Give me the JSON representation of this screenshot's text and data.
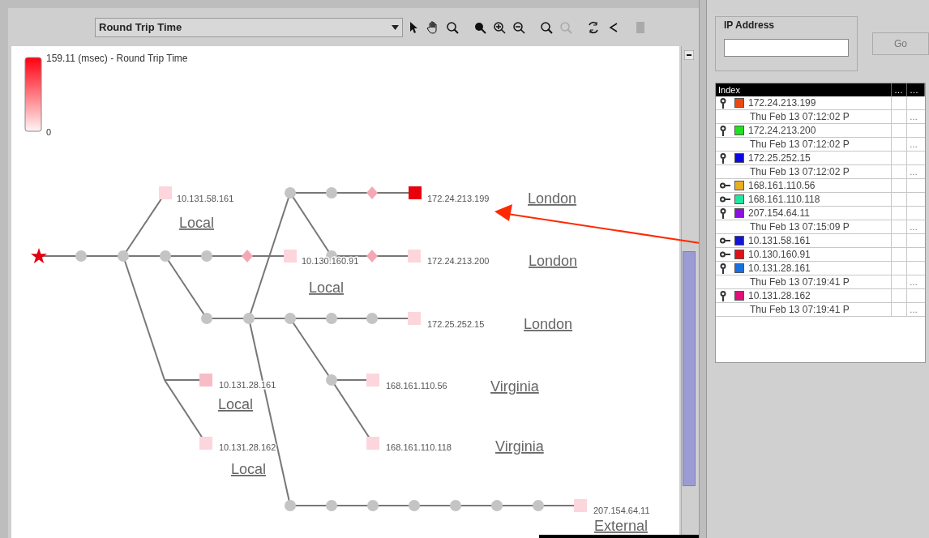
{
  "toolbar": {
    "metric_dropdown": {
      "value": "Round Trip Time"
    }
  },
  "legend": {
    "max_label": "159.11 (msec) - Round Trip Time",
    "min_label": "0"
  },
  "graph": {
    "targets": [
      {
        "ip": "10.131.58.161",
        "location": "Local",
        "color": "#fcd6dc"
      },
      {
        "ip": "172.24.213.199",
        "location": "London",
        "color": "#e8000c"
      },
      {
        "ip": "10.130.160.91",
        "location": "Local",
        "color": "#fcd6dc"
      },
      {
        "ip": "172.24.213.200",
        "location": "London",
        "color": "#fcd6dc"
      },
      {
        "ip": "172.25.252.15",
        "location": "London",
        "color": "#fcd6dc"
      },
      {
        "ip": "10.131.28.161",
        "location": "Local",
        "color": "#f8bcc6"
      },
      {
        "ip": "168.161.110.56",
        "location": "Virginia",
        "color": "#fcd6dc"
      },
      {
        "ip": "10.131.28.162",
        "location": "Local",
        "color": "#fcd6dc"
      },
      {
        "ip": "168.161.110.118",
        "location": "Virginia",
        "color": "#fcd6dc"
      },
      {
        "ip": "207.154.64.11",
        "location": "External",
        "color": "#fcd6dc"
      }
    ]
  },
  "search": {
    "label": "IP Address",
    "button": "Go",
    "button_disabled": true
  },
  "table": {
    "columns": [
      "Index",
      "…",
      "…"
    ],
    "rows": [
      {
        "ip": "172.24.213.199",
        "color": "#e84a10",
        "expanded": true,
        "children": [
          {
            "time": "Thu Feb 13 07:12:02 P",
            "column_2": "…"
          }
        ]
      },
      {
        "ip": "172.24.213.200",
        "color": "#22e022",
        "expanded": true,
        "children": [
          {
            "time": "Thu Feb 13 07:12:02 P",
            "column_2": "…"
          }
        ]
      },
      {
        "ip": "172.25.252.15",
        "color": "#0a0ae0",
        "expanded": true,
        "children": [
          {
            "time": "Thu Feb 13 07:12:02 P",
            "column_2": "…"
          }
        ]
      },
      {
        "ip": "168.161.110.56",
        "color": "#e8b020",
        "expanded": false,
        "children": []
      },
      {
        "ip": "168.161.110.118",
        "color": "#20e8a0",
        "expanded": false,
        "children": []
      },
      {
        "ip": "207.154.64.11",
        "color": "#8a10e0",
        "expanded": true,
        "children": [
          {
            "time": "Thu Feb 13 07:15:09 P",
            "column_2": "…"
          }
        ]
      },
      {
        "ip": "10.131.58.161",
        "color": "#1414d8",
        "expanded": false,
        "children": []
      },
      {
        "ip": "10.130.160.91",
        "color": "#e01018",
        "expanded": false,
        "children": []
      },
      {
        "ip": "10.131.28.161",
        "color": "#1870e0",
        "expanded": true,
        "children": [
          {
            "time": "Thu Feb 13 07:19:41 P",
            "column_2": "…"
          }
        ]
      },
      {
        "ip": "10.131.28.162",
        "color": "#e01078",
        "expanded": true,
        "children": [
          {
            "time": "Thu Feb 13 07:19:41 P",
            "column_2": "…"
          }
        ]
      }
    ]
  }
}
